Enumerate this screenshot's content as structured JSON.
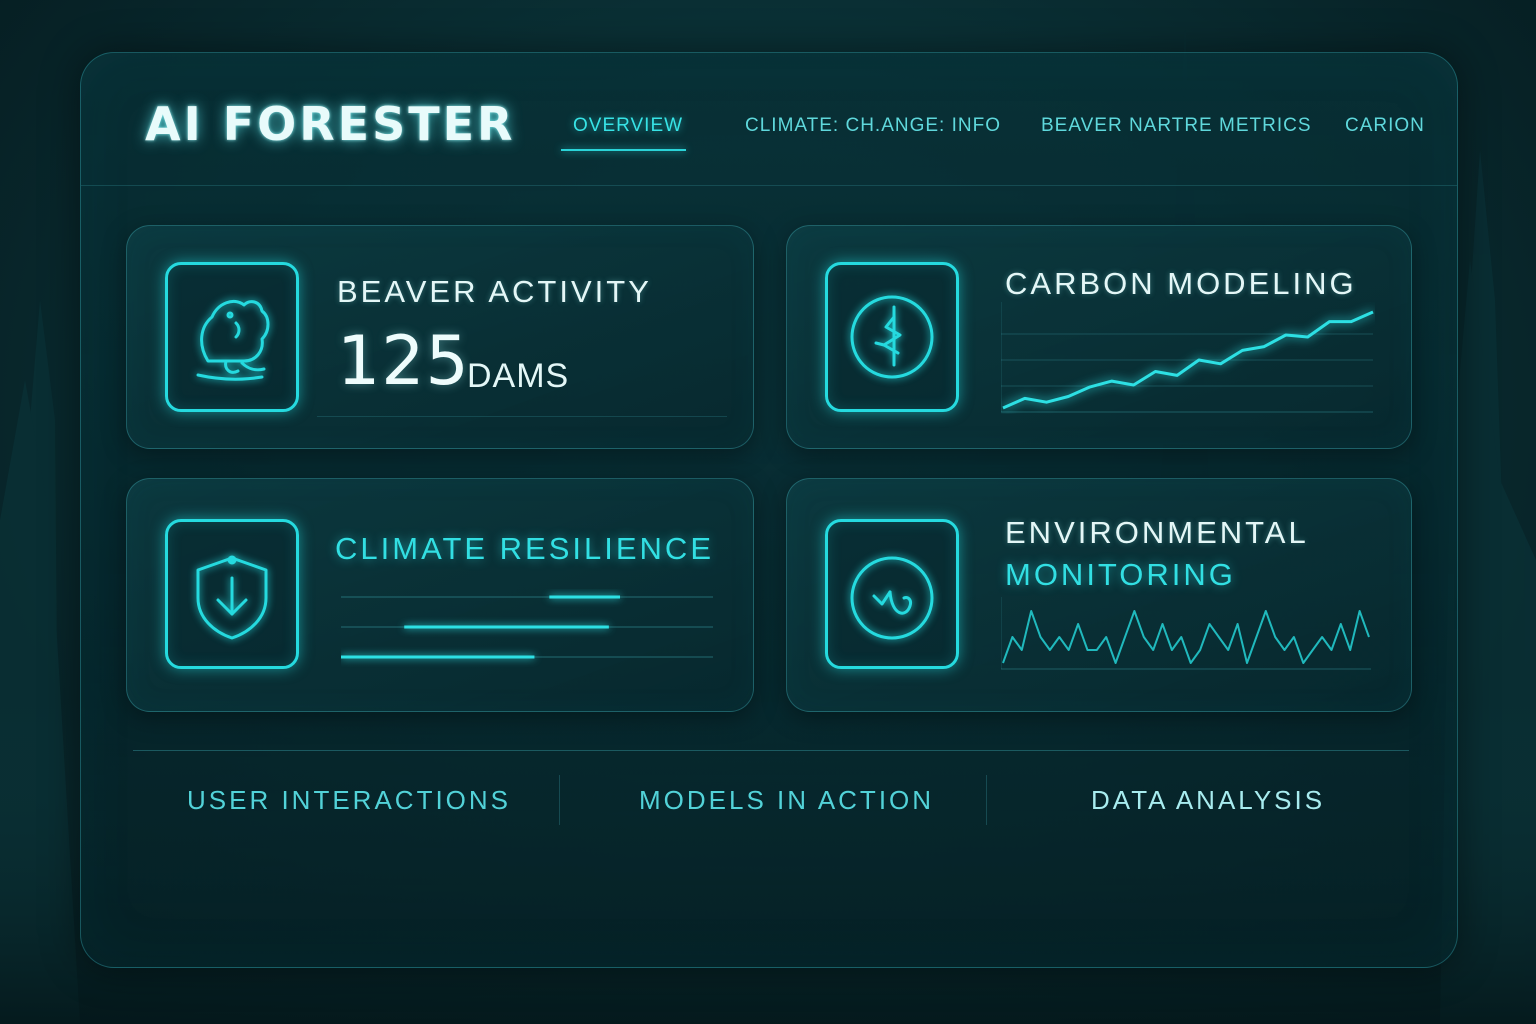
{
  "app": {
    "title": "AI FORESTER"
  },
  "nav": {
    "items": [
      {
        "label": "OVERVIEW",
        "active": true
      },
      {
        "label": "CLIMATE: CH.ANGE: INFO",
        "active": false
      },
      {
        "label": "BEAVER NARTRE METRICS",
        "active": false
      },
      {
        "label": "CARION",
        "active": false
      }
    ]
  },
  "cards": {
    "beaver": {
      "title": "BEAVER ACTIVITY",
      "value": "125",
      "unit": "DAMS",
      "icon": "beaver-icon"
    },
    "carbon": {
      "title": "CARBON MODELING",
      "icon": "carbon-leaf-icon",
      "trend": [
        1,
        2,
        1.6,
        2.2,
        3.2,
        3.8,
        3.4,
        4.8,
        4.4,
        6,
        5.6,
        7,
        7.4,
        8.6,
        8.4,
        10,
        10,
        11
      ]
    },
    "climate": {
      "title": "CLIMATE RESILIENCE",
      "icon": "shield-icon",
      "progress": [
        0.75,
        0.72,
        0.52
      ]
    },
    "environmental": {
      "title_line1": "ENVIRONMENTAL",
      "title_line2": "MONITORING",
      "icon": "monitoring-gauge-icon",
      "signal": [
        3,
        5,
        4,
        7,
        5,
        4,
        5,
        4,
        6,
        4,
        4,
        5,
        3,
        5,
        7,
        5,
        4,
        6,
        4,
        5,
        3,
        4,
        6,
        5,
        4,
        6,
        3,
        5,
        7,
        5,
        4,
        5,
        3,
        4,
        5,
        4,
        6,
        4,
        7,
        5
      ]
    }
  },
  "footer": {
    "links": [
      "USER INTERACTIONS",
      "MODELS IN ACTION",
      "DATA ANALYSIS"
    ]
  },
  "colors": {
    "accent": "#25dadf",
    "accent_text": "#32dfe3",
    "background": "#062328",
    "panel": "#08363c"
  }
}
